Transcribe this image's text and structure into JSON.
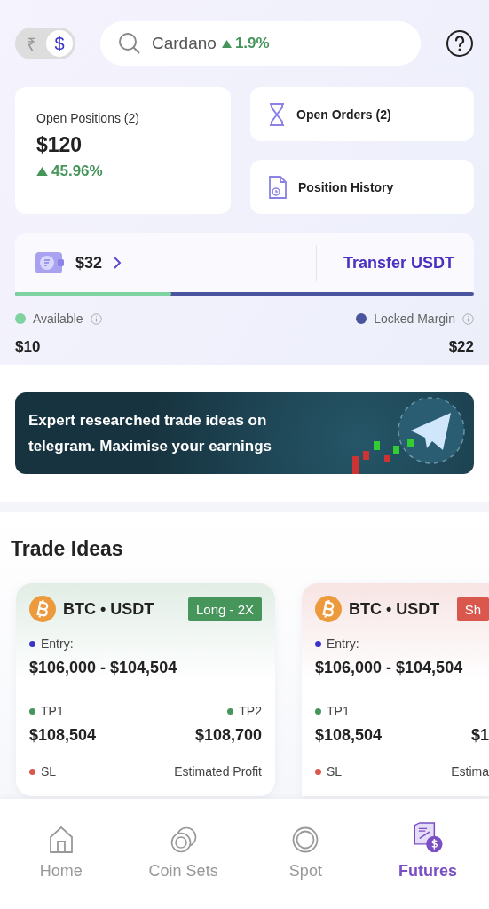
{
  "currency_toggle": [
    {
      "symbol": "₹",
      "selected": false
    },
    {
      "symbol": "$",
      "selected": true
    }
  ],
  "search": {
    "value": "Cardano",
    "change": "1.9%"
  },
  "open_positions": {
    "label": "Open Positions (2)",
    "amount": "$120",
    "change": "45.96%"
  },
  "actions": [
    {
      "kind": "orders",
      "label": "Open Orders (2)"
    },
    {
      "kind": "history",
      "label": "Position History"
    }
  ],
  "wallet": {
    "balance": "$32",
    "transfer": "Transfer USDT",
    "level": 0.34,
    "legend": [
      {
        "label": "Available",
        "value": "$10",
        "color": "#7fd3a0"
      },
      {
        "label": "Locked Margin",
        "value": "$22",
        "color": "#4b559e"
      }
    ]
  },
  "banner": {
    "text": "Expert researched trade ideas on telegram. Maximise your earnings"
  },
  "trade_ideas": {
    "title": "Trade Ideas",
    "cards": [
      {
        "pair": "BTC • USDT",
        "badge": "Long - 2X",
        "color": "#46955a",
        "entry_label": "Entry:",
        "entry": "$106,000 - $104,504",
        "tp1_label": "TP1",
        "tp1": "$108,504",
        "tp2_label": "TP2",
        "tp2": "$108,700",
        "sl_label": "SL",
        "profit_label": "Estimated Profit"
      },
      {
        "pair": "BTC • USDT",
        "badge": "Sh",
        "color": "#d9574c",
        "entry_label": "Entry:",
        "entry": "$106,000 - $104,504",
        "tp1_label": "TP1",
        "tp1": "$108,504",
        "tp2": "$1",
        "sl_label": "SL",
        "profit_label": "Estima"
      }
    ]
  },
  "nav": [
    {
      "kind": "home",
      "label": "Home",
      "selected": false
    },
    {
      "kind": "coins",
      "label": "Coin Sets",
      "selected": false
    },
    {
      "kind": "spot",
      "label": "Spot",
      "selected": false
    },
    {
      "kind": "futures",
      "label": "Futures",
      "selected": true
    }
  ]
}
